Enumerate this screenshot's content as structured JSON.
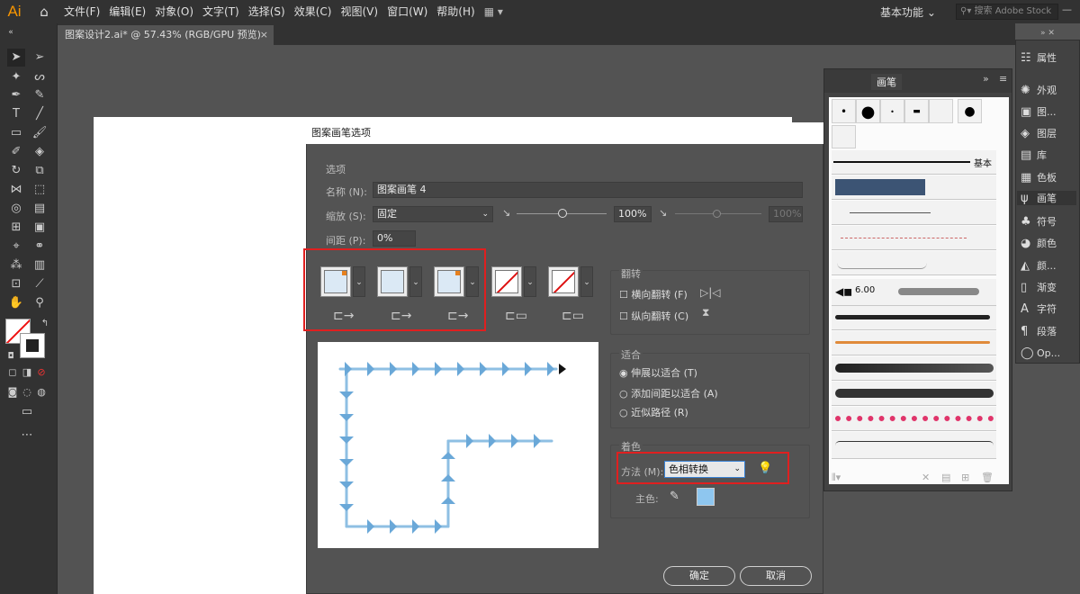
{
  "menubar": {
    "logo": "Ai",
    "items": [
      "文件(F)",
      "编辑(E)",
      "对象(O)",
      "文字(T)",
      "选择(S)",
      "效果(C)",
      "视图(V)",
      "窗口(W)",
      "帮助(H)"
    ],
    "workspace": "基本功能",
    "search_placeholder": "搜索 Adobe Stock"
  },
  "document_tab": {
    "title": "图案设计2.ai* @ 57.43% (RGB/GPU 预览)",
    "close": "×"
  },
  "dialog": {
    "title": "图案画笔选项",
    "options_header": "选项",
    "name_label": "名称 (N):",
    "name_value": "图案画笔 4",
    "scale_label": "缩放 (S):",
    "scale_value": "固定",
    "scale_percent": "100%",
    "scale_percent2": "100%",
    "spacing_label": "间距 (P):",
    "spacing_value": "0%",
    "flip_header": "翻转",
    "flip_horizontal": "横向翻转 (F)",
    "flip_vertical": "纵向翻转 (C)",
    "fit_header": "适合",
    "fit_stretch": "伸展以适合 (T)",
    "fit_spacing": "添加间距以适合 (A)",
    "fit_approx": "近似路径 (R)",
    "color_header": "着色",
    "method_label": "方法 (M):",
    "method_value": "色相转换",
    "key_color_label": "主色:",
    "ok": "确定",
    "cancel": "取消",
    "key_color": "#8ec6ef",
    "highlight_color": "#e01f1f"
  },
  "brush_panel": {
    "tab_label": "画笔",
    "basic_label": "基本",
    "size_value": "6.00"
  },
  "dock": {
    "items": [
      "属性",
      "外观",
      "图...",
      "图层",
      "库",
      "色板",
      "画笔",
      "符号",
      "颜色",
      "颜...",
      "渐变",
      "字符",
      "段落",
      "Op..."
    ]
  }
}
